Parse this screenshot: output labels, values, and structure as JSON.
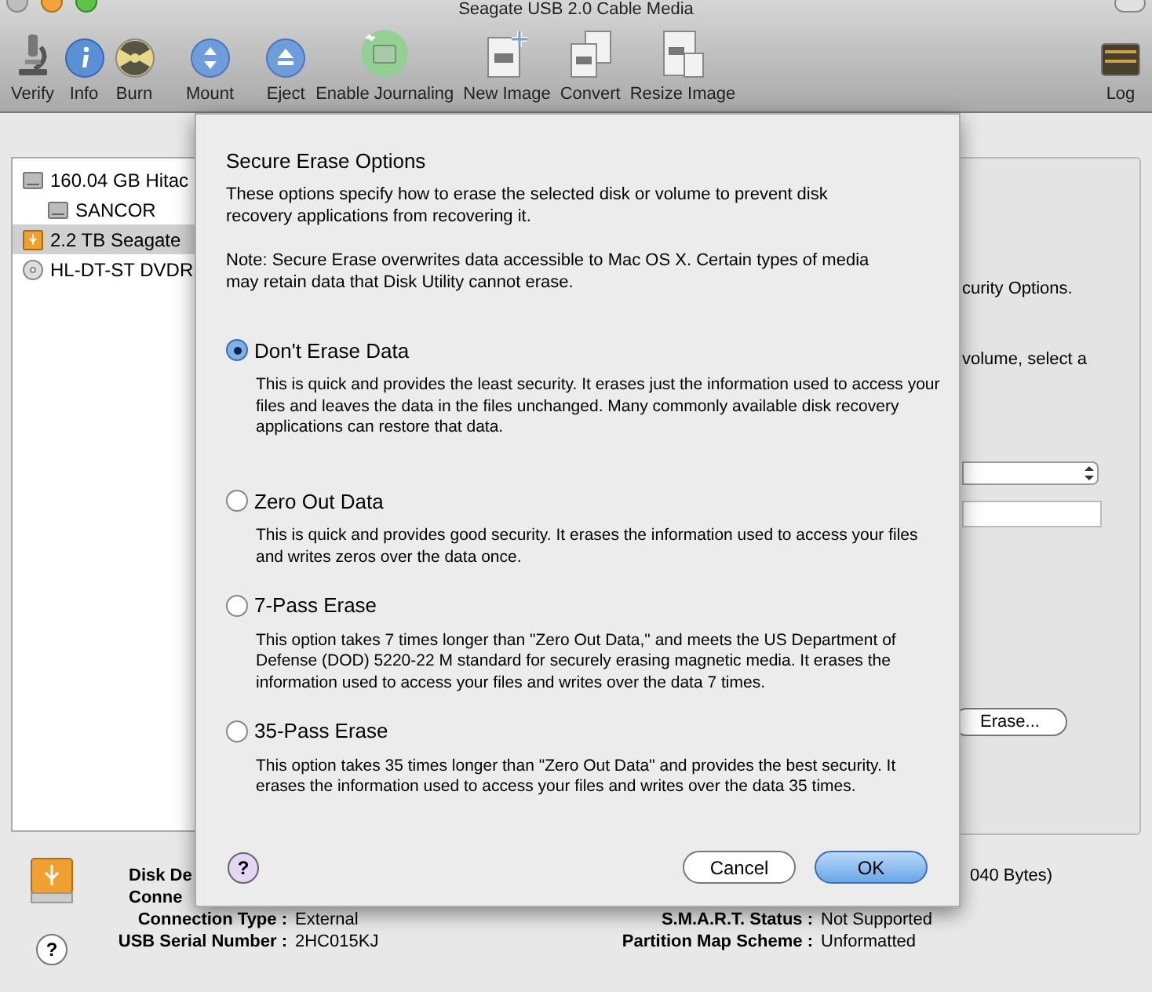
{
  "window": {
    "title": "Seagate USB 2.0 Cable Media"
  },
  "toolbar": [
    {
      "label": "Verify",
      "kind": "microscope"
    },
    {
      "label": "Info",
      "kind": "info"
    },
    {
      "label": "Burn",
      "kind": "burn"
    },
    {
      "label": "Mount",
      "kind": "mount"
    },
    {
      "label": "Eject",
      "kind": "eject"
    },
    {
      "label": "Enable Journaling",
      "kind": "journal"
    },
    {
      "label": "New Image",
      "kind": "newimage"
    },
    {
      "label": "Convert",
      "kind": "convert"
    },
    {
      "label": "Resize Image",
      "kind": "resize"
    },
    {
      "label": "Log",
      "kind": "log"
    }
  ],
  "sidebar": {
    "items": [
      {
        "label": "160.04 GB Hitac",
        "kind": "disk",
        "selected": false,
        "children": [
          {
            "label": "SANCOR",
            "kind": "disk",
            "selected": false
          }
        ]
      },
      {
        "label": "2.2 TB Seagate",
        "kind": "usb",
        "selected": true
      },
      {
        "label": "HL-DT-ST DVDR",
        "kind": "optical",
        "selected": false
      }
    ]
  },
  "erase_panel": {
    "instructions": [
      "curity Options.",
      "volume, select a"
    ],
    "erase_button": "Erase..."
  },
  "info": {
    "left": [
      {
        "label": "Disk De"
      },
      {
        "label": "Conne"
      },
      {
        "label": "Connection Type :",
        "value": "External"
      },
      {
        "label": "USB Serial Number :",
        "value": "2HC015KJ"
      }
    ],
    "right": [
      {
        "value": "040 Bytes)"
      },
      {
        "label": "S.M.A.R.T. Status :",
        "value": "Not Supported"
      },
      {
        "label": "Partition Map Scheme :",
        "value": "Unformatted"
      }
    ],
    "help": "?"
  },
  "sheet": {
    "title": "Secure Erase Options",
    "intro": "These options specify how to erase the selected disk or volume to prevent disk recovery applications from recovering it.",
    "note": "Note: Secure Erase overwrites data accessible to Mac OS X.  Certain types of media may retain data that Disk Utility cannot erase.",
    "options": [
      {
        "label": "Don't Erase Data",
        "selected": true,
        "description": "This is quick and provides the least security. It erases just the information used to access your files and leaves the data in the files unchanged. Many commonly available disk recovery applications can restore that data."
      },
      {
        "label": "Zero Out Data",
        "selected": false,
        "description": "This is quick and provides good security. It erases the information used to access your files and writes zeros over the data once."
      },
      {
        "label": "7-Pass Erase",
        "selected": false,
        "description": "This option takes 7 times longer than \"Zero Out Data,\" and meets the US Department of Defense (DOD) 5220-22 M standard for securely erasing magnetic media. It erases the information used to access your files and writes over the data 7 times."
      },
      {
        "label": "35-Pass Erase",
        "selected": false,
        "description": "This option takes 35 times longer than \"Zero Out Data\" and provides the best security. It erases the information used to access your files and writes over the data 35 times."
      }
    ],
    "help": "?",
    "cancel": "Cancel",
    "ok": "OK"
  }
}
